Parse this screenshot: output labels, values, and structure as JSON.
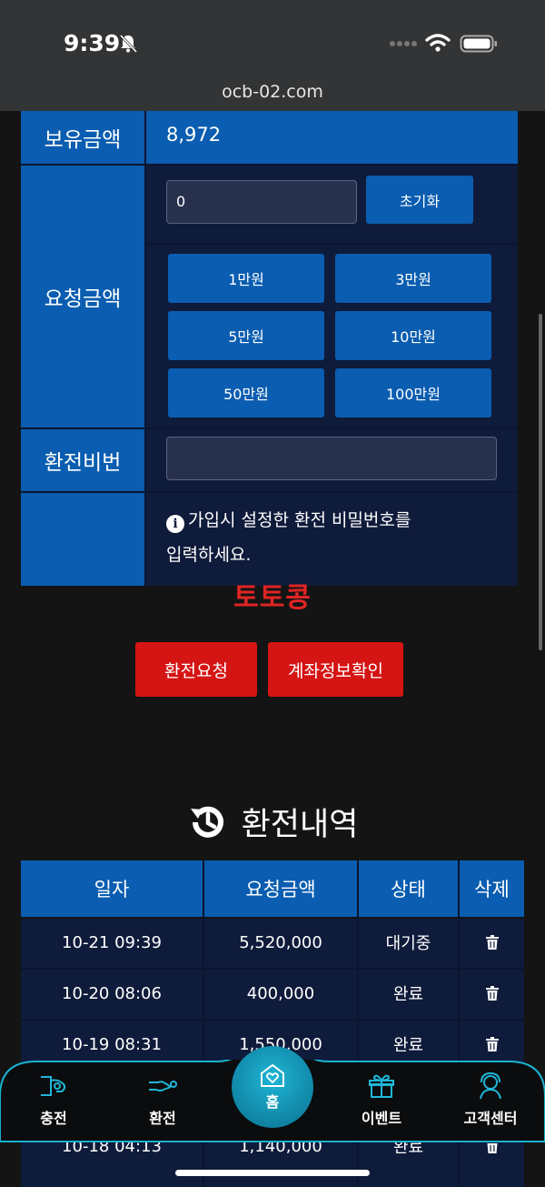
{
  "status_bar": {
    "time": "9:39",
    "url": "ocb-02.com"
  },
  "form": {
    "balance_label": "보유금액",
    "balance_value": "8,972",
    "request_label": "요청금액",
    "amount_value": "0",
    "reset_label": "초기화",
    "quick_amounts": [
      "1만원",
      "3만원",
      "5만원",
      "10만원",
      "50만원",
      "100만원"
    ],
    "password_label": "환전비번",
    "notice_line1": "가입시 설정한 환전 비밀번호를",
    "notice_line2": "입력하세요."
  },
  "watermark": "토토콩",
  "actions": {
    "withdraw_request": "환전요청",
    "account_check": "계좌정보확인"
  },
  "history": {
    "title": "환전내역",
    "columns": [
      "일자",
      "요청금액",
      "상태",
      "삭제"
    ],
    "rows": [
      {
        "date": "10-21 09:39",
        "amount": "5,520,000",
        "status": "대기중"
      },
      {
        "date": "10-20 08:06",
        "amount": "400,000",
        "status": "완료"
      },
      {
        "date": "10-19 08:31",
        "amount": "1,550,000",
        "status": "완료"
      },
      {
        "date": "10-18 04:13",
        "amount": "1,140,000",
        "status": "완료"
      }
    ]
  },
  "nav": {
    "deposit": "충전",
    "withdraw": "환전",
    "home": "홈",
    "event": "이벤트",
    "support": "고객센터"
  },
  "colors": {
    "primary_blue": "#0a5db0",
    "dark_navy": "#0f1b3a",
    "action_red": "#d51414",
    "nav_teal": "#1fb6d6"
  }
}
